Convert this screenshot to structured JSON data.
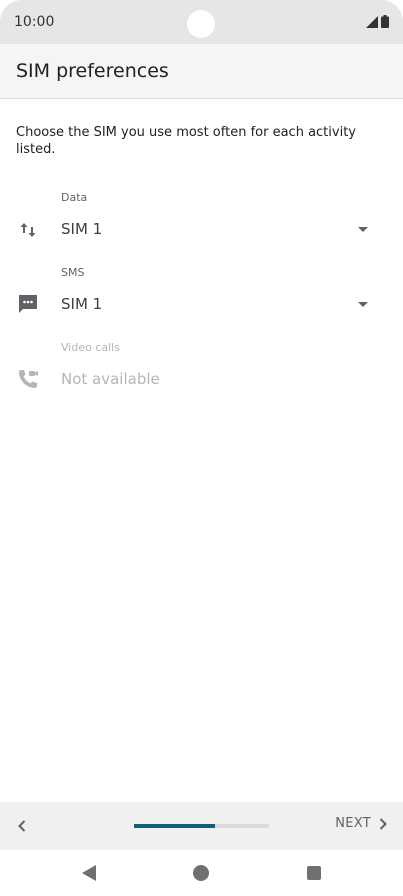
{
  "status_bar": {
    "time": "10:00",
    "icons": [
      "signal-icon",
      "battery-icon"
    ]
  },
  "app_bar": {
    "title": "SIM preferences"
  },
  "description": "Choose the SIM you use most often for each activity listed.",
  "preferences": [
    {
      "label": "Data",
      "value": "SIM 1",
      "icon": "data-transfer-icon",
      "enabled": true
    },
    {
      "label": "SMS",
      "value": "SIM 1",
      "icon": "sms-icon",
      "enabled": true
    },
    {
      "label": "Video calls",
      "value": "Not available",
      "icon": "video-call-icon",
      "enabled": false
    }
  ],
  "bottom_bar": {
    "next_label": "NEXT",
    "progress_percent": 60
  },
  "colors": {
    "accent": "#0f5e7a",
    "status_bar_bg": "#e6e6e6",
    "app_bar_bg": "#f5f5f5",
    "disabled_text": "#b5b5b5"
  }
}
